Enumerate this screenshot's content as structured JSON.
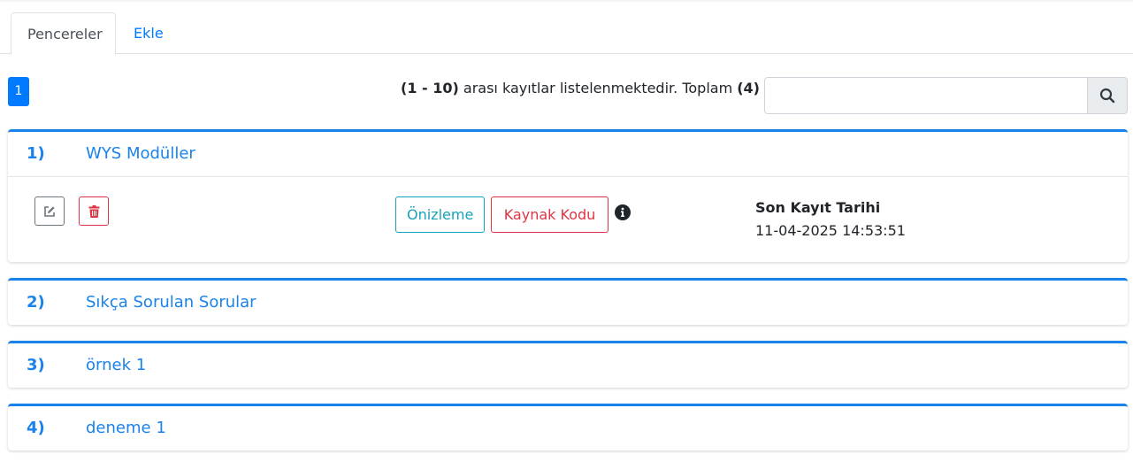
{
  "tabs": [
    {
      "label": "Pencereler",
      "active": true
    },
    {
      "label": "Ekle",
      "active": false
    }
  ],
  "pagination": {
    "current_page": "1"
  },
  "summary": {
    "range": "(1 - 10)",
    "middle": " arası kayıtlar listelenmektedir. Toplam ",
    "total": "(4)"
  },
  "search": {
    "placeholder": "",
    "value": "",
    "button_icon": "search-icon"
  },
  "colors": {
    "primary": "#1a82ec",
    "danger": "#dc3545",
    "info": "#17a2b8"
  },
  "items": [
    {
      "number": "1)",
      "title": "WYS Modüller",
      "expanded": true,
      "preview_label": "Önizleme",
      "source_label": "Kaynak Kodu",
      "last_saved_label": "Son Kayıt Tarihi",
      "last_saved_value": "11-04-2025 14:53:51"
    },
    {
      "number": "2)",
      "title": "Sıkça Sorulan Sorular",
      "expanded": false
    },
    {
      "number": "3)",
      "title": "örnek 1",
      "expanded": false
    },
    {
      "number": "4)",
      "title": "deneme 1",
      "expanded": false
    }
  ]
}
